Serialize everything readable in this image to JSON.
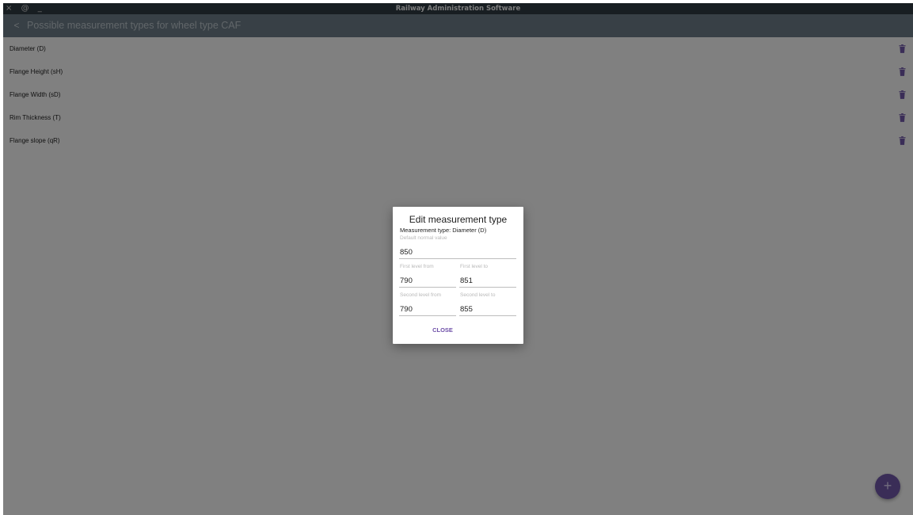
{
  "window": {
    "title": "Railway Administration Software",
    "controls": [
      "×",
      "@",
      "_"
    ]
  },
  "appbar": {
    "back_icon": "<",
    "title": "Possible measurement types for wheel type CAF"
  },
  "list": {
    "items": [
      {
        "label": "Diameter (D)"
      },
      {
        "label": "Flange Height (sH)"
      },
      {
        "label": "Flange Width (sD)"
      },
      {
        "label": "Rim Thickness (T)"
      },
      {
        "label": "Flange slope (qR)"
      }
    ],
    "delete_icon": "trash-icon",
    "icon_color": "#6e56a4"
  },
  "fab": {
    "label": "+"
  },
  "dialog": {
    "title": "Edit measurement type",
    "subtitle": "Measurement type: Diameter (D)",
    "default_normal": {
      "label": "Default normal value",
      "value": "850"
    },
    "first_from": {
      "label": "First level from",
      "value": "790"
    },
    "first_to": {
      "label": "First level to",
      "value": "851"
    },
    "second_from": {
      "label": "Second level from",
      "value": "790"
    },
    "second_to": {
      "label": "Second level to",
      "value": "855"
    },
    "close_label": "CLOSE"
  },
  "colors": {
    "titlebar": "#2f3a41",
    "appbar": "#6a7a85",
    "accent": "#6e56a4"
  }
}
